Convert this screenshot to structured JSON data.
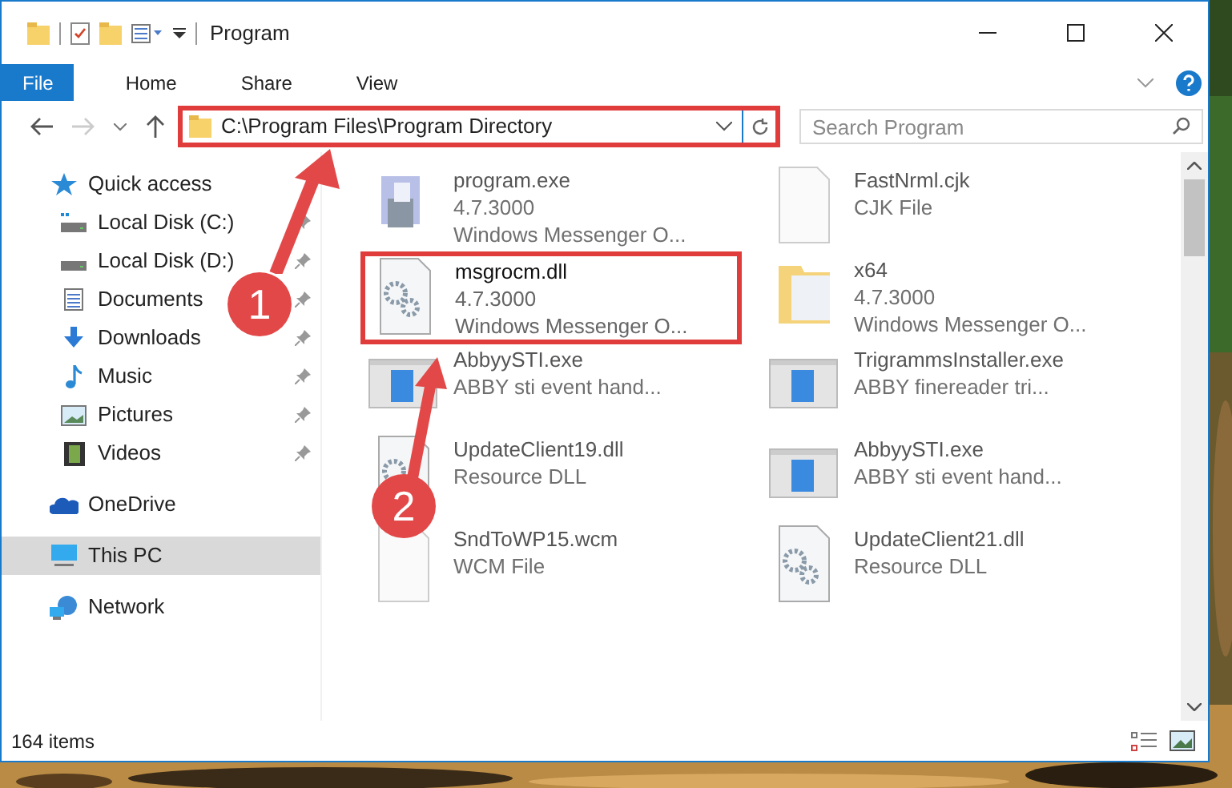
{
  "window": {
    "title": "Program"
  },
  "ribbon_tabs": [
    {
      "label": "File",
      "selected": true
    },
    {
      "label": "Home",
      "selected": false
    },
    {
      "label": "Share",
      "selected": false
    },
    {
      "label": "View",
      "selected": false
    }
  ],
  "address": {
    "path": "C:\\Program Files\\Program Directory",
    "highlighted": true
  },
  "search": {
    "placeholder": "Search Program"
  },
  "sidebar": {
    "items": [
      {
        "label": "Quick access",
        "kind": "star",
        "selected": false,
        "children": [
          {
            "label": "Local Disk (C:)",
            "kind": "drive-c",
            "pinned": true,
            "selected": false
          },
          {
            "label": "Local Disk (D:)",
            "kind": "drive",
            "pinned": true,
            "selected": false
          },
          {
            "label": "Documents",
            "kind": "documents",
            "pinned": true,
            "selected": false
          },
          {
            "label": "Downloads",
            "kind": "downloads",
            "pinned": true,
            "selected": false
          },
          {
            "label": "Music",
            "kind": "music",
            "pinned": true,
            "selected": false
          },
          {
            "label": "Pictures",
            "kind": "pictures",
            "pinned": true,
            "selected": false
          },
          {
            "label": "Videos",
            "kind": "videos",
            "pinned": true,
            "selected": false
          }
        ]
      },
      {
        "label": "OneDrive",
        "kind": "cloud",
        "selected": false
      },
      {
        "label": "This PC",
        "kind": "pc",
        "selected": true
      },
      {
        "label": "Network",
        "kind": "network",
        "selected": false
      }
    ]
  },
  "files": [
    {
      "name": "program.exe",
      "lines": [
        "4.7.3000",
        "Windows Messenger O..."
      ],
      "kind": "app",
      "blurred": true,
      "highlighted": false
    },
    {
      "name": "FastNrml.cjk",
      "lines": [
        "CJK File"
      ],
      "kind": "blank",
      "blurred": true,
      "highlighted": false
    },
    {
      "name": "msgrocm.dll",
      "lines": [
        "4.7.3000",
        "Windows Messenger O..."
      ],
      "kind": "gears",
      "blurred": false,
      "highlighted": true
    },
    {
      "name": "x64",
      "lines": [
        "4.7.3000",
        "Windows Messenger O..."
      ],
      "kind": "folder",
      "blurred": true,
      "highlighted": false
    },
    {
      "name": "AbbyySTI.exe",
      "lines": [
        "ABBY sti event hand..."
      ],
      "kind": "window",
      "blurred": true,
      "highlighted": false
    },
    {
      "name": "TrigrammsInstaller.exe",
      "lines": [
        "ABBY finereader tri..."
      ],
      "kind": "window",
      "blurred": true,
      "highlighted": false
    },
    {
      "name": "UpdateClient19.dll",
      "lines": [
        "Resource DLL"
      ],
      "kind": "gears",
      "blurred": true,
      "highlighted": false
    },
    {
      "name": "AbbyySTI.exe",
      "lines": [
        "ABBY sti event hand..."
      ],
      "kind": "window",
      "blurred": true,
      "highlighted": false
    },
    {
      "name": "SndToWP15.wcm",
      "lines": [
        "WCM File"
      ],
      "kind": "blank",
      "blurred": true,
      "highlighted": false
    },
    {
      "name": "UpdateClient21.dll",
      "lines": [
        "Resource DLL"
      ],
      "kind": "gears",
      "blurred": true,
      "highlighted": false
    }
  ],
  "status_bar": {
    "count": "164 items"
  },
  "annotations": [
    {
      "number": "1"
    },
    {
      "number": "2"
    }
  ]
}
